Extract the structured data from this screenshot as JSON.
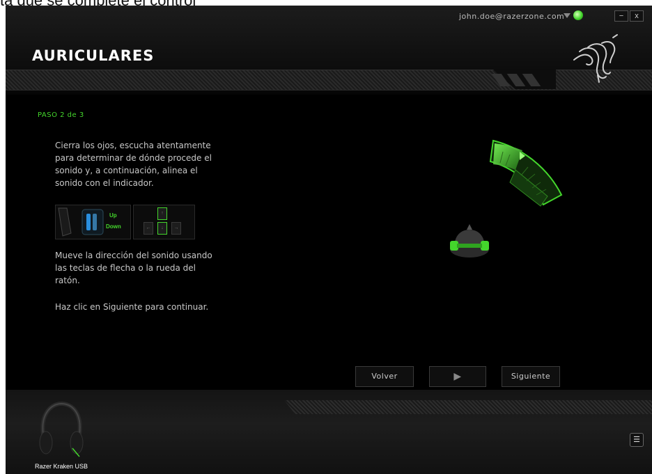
{
  "caption_fragment": "ta que se complete el control",
  "window": {
    "title": "AURICULARES",
    "account": "john.doe@razerzone.com",
    "minimize_label": "−",
    "close_label": "x"
  },
  "step": {
    "label": "PASO 2 de 3",
    "instruction_1": "Cierra los ojos, escucha atentamente para determinar de dónde procede el sonido y, a continuación, alinea el sonido con el indicador.",
    "instruction_2": "Mueve la dirección del sonido usando las teclas de flecha o la rueda del ratón.",
    "instruction_3": "Haz clic en Siguiente para continuar."
  },
  "mouse_illustration": {
    "up_label": "Up",
    "down_label": "Down"
  },
  "keys": {
    "up": "↑",
    "left": "←",
    "down": "↓",
    "right": "→"
  },
  "buttons": {
    "back": "Volver",
    "play": "▶",
    "next": "Siguiente"
  },
  "device": {
    "name": "Razer Kraken USB"
  },
  "menu_icon": "☰",
  "colors": {
    "accent": "#44d62c",
    "background": "#000000"
  }
}
